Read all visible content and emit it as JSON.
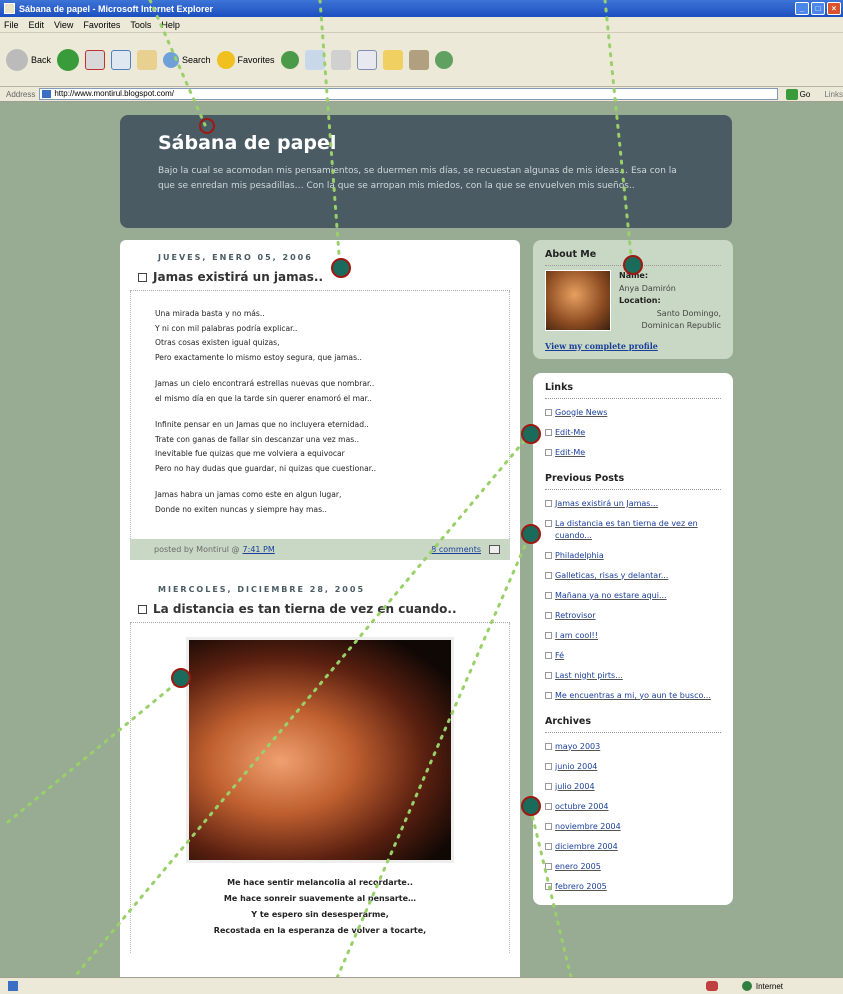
{
  "window": {
    "title": "Sábana de papel - Microsoft Internet Explorer"
  },
  "menu": [
    "File",
    "Edit",
    "View",
    "Favorites",
    "Tools",
    "Help"
  ],
  "toolbar": {
    "back": "Back",
    "search": "Search",
    "favorites": "Favorites"
  },
  "address": {
    "label": "Address",
    "url": "http://www.montirul.blogspot.com/",
    "go": "Go",
    "links": "Links"
  },
  "status": {
    "zone": "Internet"
  },
  "blog": {
    "title": "Sábana de papel",
    "description": "Bajo la cual se acomodan mis pensamientos, se duermen mis días, se recuestan algunas de mis ideas… Esa con la que se enredan mis pesadillas… Con la que se arropan mis miedos, con la que se envuelven mis sueños.."
  },
  "posts": [
    {
      "date": "JUEVES, ENERO 05, 2006",
      "title": "Jamas existirá un jamas..",
      "stanzas": [
        [
          "Una mirada basta y no más..",
          "Y ni con mil palabras podría explicar..",
          "Otras cosas existen igual quizas,",
          "Pero exactamente lo mismo estoy segura, que jamas.."
        ],
        [
          "Jamas un cielo encontrará estrellas nuevas que nombrar..",
          "el mismo día en que la tarde sin querer enamoró el mar.."
        ],
        [
          "Infinite pensar en un Jamas que no incluyera eternidad..",
          "Trate con ganas de fallar sin descanzar una vez mas..",
          "Inevitable fue quizas que me volviera a equivocar",
          "Pero no hay dudas que guardar, ni quizas que cuestionar.."
        ],
        [
          "Jamas habra un jamas como este en algun lugar,",
          "Donde no exiten nuncas y siempre hay mas.."
        ]
      ],
      "footer": {
        "posted_by": "posted by Montirul @",
        "time": "7:41 PM",
        "comments": "8 comments"
      }
    },
    {
      "date": "MIERCOLES, DICIEMBRE 28, 2005",
      "title": "La distancia es tan tierna de vez en cuando..",
      "caption": [
        "Me hace sentir melancolia al recordarte..",
        "Me hace sonreir suavemente al pensarte…",
        "Y te espero sin desesperarme,",
        "Recostada en la esperanza de volver a tocarte,"
      ]
    }
  ],
  "about": {
    "heading": "About Me",
    "name_label": "Name:",
    "name": "Anya Damirón",
    "location_label": "Location:",
    "location": "Santo Domingo, Dominican Republic",
    "profile_link": "View my complete profile"
  },
  "links": {
    "heading": "Links",
    "items": [
      "Google News",
      "Edit-Me",
      "Edit-Me"
    ]
  },
  "previous_posts": {
    "heading": "Previous Posts",
    "items": [
      "Jamas existirá un Jamas...",
      "La distancia es tan tierna de vez en cuando...",
      "Philadelphia",
      "Galleticas, risas y delantar...",
      "Mañana ya no estare aqui...",
      "Retrovisor",
      "I am cool!!",
      "Fé",
      "Last night pirts...",
      "Me encuentras a mi, yo aun te busco..."
    ]
  },
  "archives": {
    "heading": "Archives",
    "items": [
      "mayo 2003",
      "junio 2004",
      "julio 2004",
      "octubre 2004",
      "noviembre 2004",
      "diciembre 2004",
      "enero 2005",
      "febrero 2005"
    ]
  }
}
